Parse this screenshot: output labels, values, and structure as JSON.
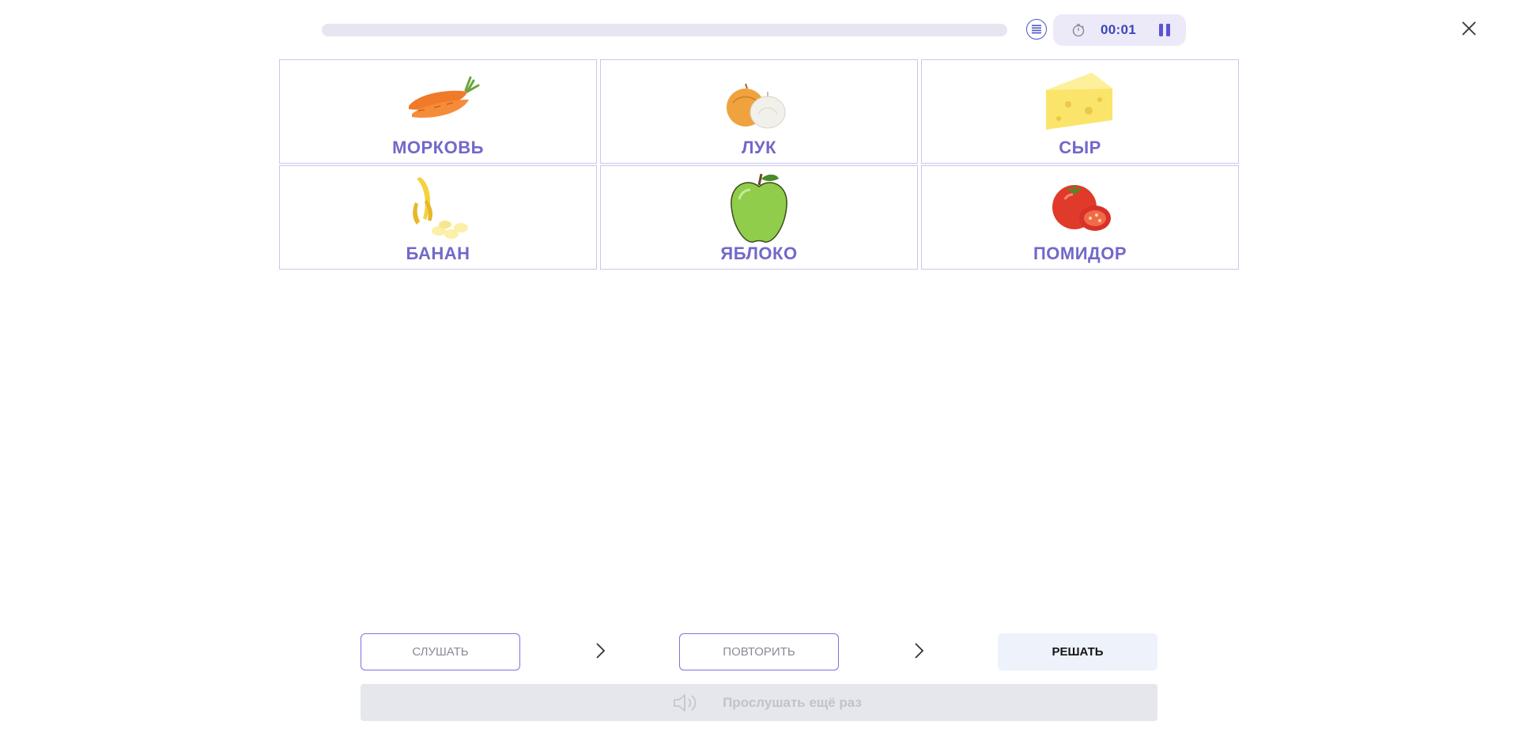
{
  "header": {
    "progress_value": 0,
    "timer": "00:01",
    "icons": {
      "list": "list-icon",
      "timer": "stopwatch-icon",
      "pause": "pause-icon",
      "close": "close-icon"
    }
  },
  "cards": [
    {
      "word": "МОРКОВЬ",
      "icon": "carrot"
    },
    {
      "word": "ЛУК",
      "icon": "onion-garlic"
    },
    {
      "word": "СЫР",
      "icon": "cheese"
    },
    {
      "word": "БАНАН",
      "icon": "banana"
    },
    {
      "word": "ЯБЛОКО",
      "icon": "apple"
    },
    {
      "word": "ПОМИДОР",
      "icon": "tomato"
    }
  ],
  "steps": {
    "listen": "СЛУШАТЬ",
    "repeat": "ПОВТОРИТЬ",
    "solve": "РЕШАТЬ"
  },
  "replay": {
    "label": "Прослушать ещё раз",
    "icon": "speaker-icon"
  },
  "colors": {
    "accent": "#7268c9",
    "timer_text": "#3b46b8",
    "card_border": "#c9c6f0",
    "solve_bg": "#edf2fb"
  }
}
